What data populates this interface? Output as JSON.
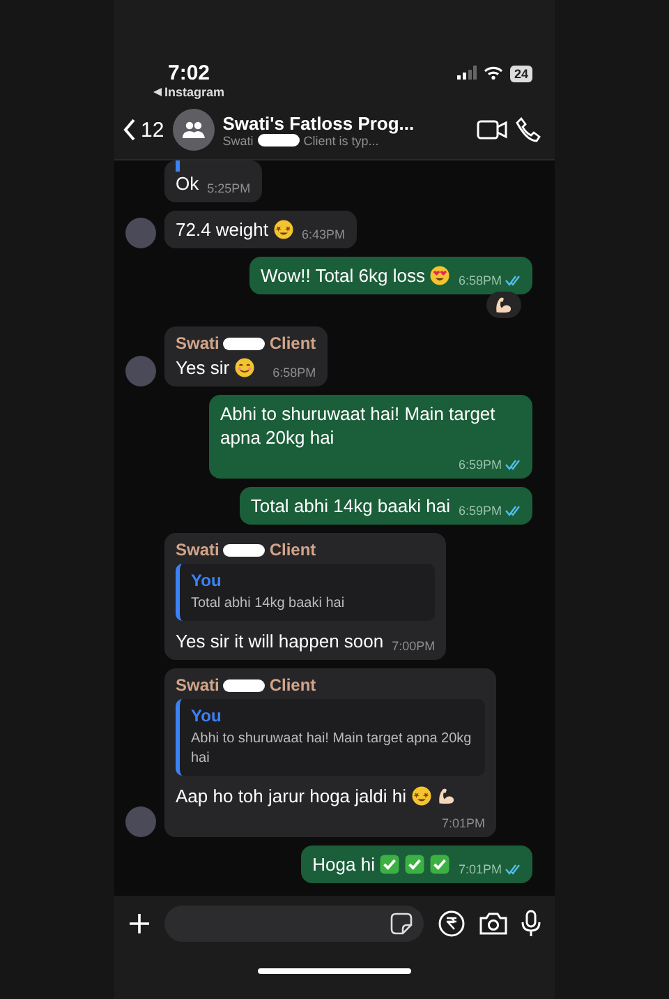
{
  "status_bar": {
    "time": "7:02",
    "back_app": "Instagram",
    "battery": "24"
  },
  "header": {
    "back_count": "12",
    "title": "Swati's Fatloss Prog...",
    "subtitle_start": "Swati",
    "subtitle_end": "Client is typ..."
  },
  "messages": [
    {
      "kind": "incoming",
      "quoted_stub": true,
      "avatar": false,
      "text": "Ok",
      "time": "5:25PM"
    },
    {
      "kind": "incoming",
      "avatar": true,
      "text": "72.4 weight",
      "time": "6:43PM",
      "icons": [
        {
          "kind": "star-eyes"
        }
      ]
    },
    {
      "kind": "outgoing",
      "text": "Wow!! Total 6kg loss",
      "time": "6:58PM",
      "read": true,
      "icons": [
        {
          "kind": "heart-eyes"
        }
      ],
      "reaction": {
        "kind": "flexed-arm"
      }
    },
    {
      "kind": "incoming",
      "avatar": true,
      "sender_start": "Swati",
      "sender_end": "Client",
      "text": "Yes sir",
      "time": "6:58PM",
      "icons": [
        {
          "kind": "smiling"
        }
      ]
    },
    {
      "kind": "outgoing",
      "text": "Abhi to shuruwaat hai! Main target apna 20kg hai",
      "time": "6:59PM",
      "read": true
    },
    {
      "kind": "outgoing",
      "text": "Total abhi 14kg baaki hai",
      "time": "6:59PM",
      "read": true
    },
    {
      "kind": "incoming",
      "avatar": false,
      "sender_start": "Swati",
      "sender_end": "Client",
      "quote": {
        "author": "You",
        "text": "Total abhi 14kg baaki hai"
      },
      "text": "Yes sir it will happen soon",
      "time": "7:00PM"
    },
    {
      "kind": "incoming",
      "avatar": true,
      "sender_start": "Swati",
      "sender_end": "Client",
      "quote": {
        "author": "You",
        "text": "Abhi to shuruwaat hai! Main target apna 20kg hai"
      },
      "text": "Aap ho toh jarur hoga jaldi hi",
      "time": "7:01PM",
      "icons": [
        {
          "kind": "star-eyes"
        },
        {
          "kind": "flexed-arm"
        }
      ]
    },
    {
      "kind": "outgoing",
      "text": "Hoga hi",
      "time": "7:01PM",
      "read": true,
      "icons": [
        {
          "kind": "check"
        },
        {
          "kind": "check"
        },
        {
          "kind": "check"
        }
      ]
    }
  ]
}
